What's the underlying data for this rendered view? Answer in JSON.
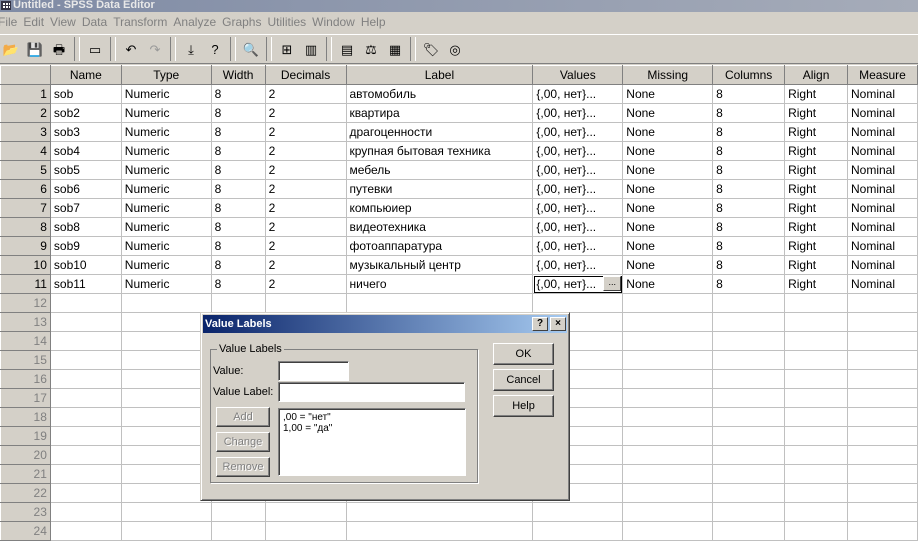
{
  "window": {
    "title": "Untitled - SPSS Data Editor"
  },
  "menu": [
    "File",
    "Edit",
    "View",
    "Data",
    "Transform",
    "Analyze",
    "Graphs",
    "Utilities",
    "Window",
    "Help"
  ],
  "columns": [
    "Name",
    "Type",
    "Width",
    "Decimals",
    "Label",
    "Values",
    "Missing",
    "Columns",
    "Align",
    "Measure"
  ],
  "rows": [
    {
      "num": "1",
      "name": "sob",
      "type": "Numeric",
      "width": "8",
      "decimals": "2",
      "label": "автомобиль",
      "values": "{,00, нет}...",
      "missing": "None",
      "columns": "8",
      "align": "Right",
      "measure": "Nominal"
    },
    {
      "num": "2",
      "name": "sob2",
      "type": "Numeric",
      "width": "8",
      "decimals": "2",
      "label": "квартира",
      "values": "{,00, нет}...",
      "missing": "None",
      "columns": "8",
      "align": "Right",
      "measure": "Nominal"
    },
    {
      "num": "3",
      "name": "sob3",
      "type": "Numeric",
      "width": "8",
      "decimals": "2",
      "label": "драгоценности",
      "values": "{,00, нет}...",
      "missing": "None",
      "columns": "8",
      "align": "Right",
      "measure": "Nominal"
    },
    {
      "num": "4",
      "name": "sob4",
      "type": "Numeric",
      "width": "8",
      "decimals": "2",
      "label": "крупная бытовая техника",
      "values": "{,00, нет}...",
      "missing": "None",
      "columns": "8",
      "align": "Right",
      "measure": "Nominal"
    },
    {
      "num": "5",
      "name": "sob5",
      "type": "Numeric",
      "width": "8",
      "decimals": "2",
      "label": "мебель",
      "values": "{,00, нет}...",
      "missing": "None",
      "columns": "8",
      "align": "Right",
      "measure": "Nominal"
    },
    {
      "num": "6",
      "name": "sob6",
      "type": "Numeric",
      "width": "8",
      "decimals": "2",
      "label": "путевки",
      "values": "{,00, нет}...",
      "missing": "None",
      "columns": "8",
      "align": "Right",
      "measure": "Nominal"
    },
    {
      "num": "7",
      "name": "sob7",
      "type": "Numeric",
      "width": "8",
      "decimals": "2",
      "label": "компьюиер",
      "values": "{,00, нет}...",
      "missing": "None",
      "columns": "8",
      "align": "Right",
      "measure": "Nominal"
    },
    {
      "num": "8",
      "name": "sob8",
      "type": "Numeric",
      "width": "8",
      "decimals": "2",
      "label": "видеотехника",
      "values": "{,00, нет}...",
      "missing": "None",
      "columns": "8",
      "align": "Right",
      "measure": "Nominal"
    },
    {
      "num": "9",
      "name": "sob9",
      "type": "Numeric",
      "width": "8",
      "decimals": "2",
      "label": "фотоаппаратура",
      "values": "{,00, нет}...",
      "missing": "None",
      "columns": "8",
      "align": "Right",
      "measure": "Nominal"
    },
    {
      "num": "10",
      "name": "sob10",
      "type": "Numeric",
      "width": "8",
      "decimals": "2",
      "label": "музыкальный центр",
      "values": "{,00, нет}...",
      "missing": "None",
      "columns": "8",
      "align": "Right",
      "measure": "Nominal"
    },
    {
      "num": "11",
      "name": "sob11",
      "type": "Numeric",
      "width": "8",
      "decimals": "2",
      "label": "ничего",
      "values": "{,00, нет}...",
      "missing": "None",
      "columns": "8",
      "align": "Right",
      "measure": "Nominal"
    }
  ],
  "empty_rows": [
    "12",
    "13",
    "14",
    "15",
    "16",
    "17",
    "18",
    "19",
    "20",
    "21",
    "22",
    "23",
    "24"
  ],
  "cell_button": "...",
  "dialog": {
    "title": "Value Labels",
    "help_glyph": "?",
    "close_glyph": "×",
    "group_label": "Value Labels",
    "value_label": "Value:",
    "value_input": "",
    "value_label_label": "Value Label:",
    "value_label_input": "",
    "list": [
      ",00 = \"нет\"",
      "1,00 = \"да\""
    ],
    "add": "Add",
    "change": "Change",
    "remove": "Remove",
    "ok": "OK",
    "cancel": "Cancel",
    "help": "Help"
  }
}
